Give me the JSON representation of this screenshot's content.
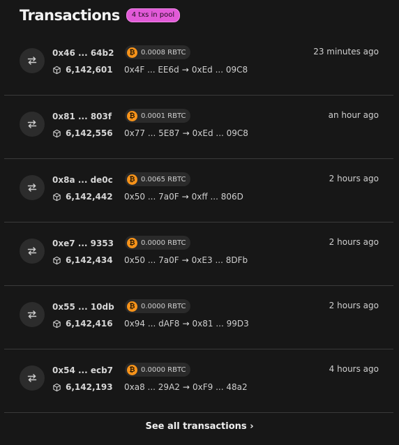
{
  "header": {
    "title": "Transactions",
    "pool_badge": "4 txs in pool"
  },
  "transactions": [
    {
      "hash": "0x46 ... 64b2",
      "block": "6,142,601",
      "amount": "0.0008 RBTC",
      "from": "0x4F ... EE6d",
      "to": "0xEd ... 09C8",
      "time": "23 minutes ago"
    },
    {
      "hash": "0x81 ... 803f",
      "block": "6,142,556",
      "amount": "0.0001 RBTC",
      "from": "0x77 ... 5E87",
      "to": "0xEd ... 09C8",
      "time": "an hour ago"
    },
    {
      "hash": "0x8a ... de0c",
      "block": "6,142,442",
      "amount": "0.0065 RBTC",
      "from": "0x50 ... 7a0F",
      "to": "0xff ... 806D",
      "time": "2 hours ago"
    },
    {
      "hash": "0xe7 ... 9353",
      "block": "6,142,434",
      "amount": "0.0000 RBTC",
      "from": "0x50 ... 7a0F",
      "to": "0xE3 ... 8DFb",
      "time": "2 hours ago"
    },
    {
      "hash": "0x55 ... 10db",
      "block": "6,142,416",
      "amount": "0.0000 RBTC",
      "from": "0x94 ... dAF8",
      "to": "0x81 ... 99D3",
      "time": "2 hours ago"
    },
    {
      "hash": "0x54 ... ecb7",
      "block": "6,142,193",
      "amount": "0.0000 RBTC",
      "from": "0xa8 ... 29A2",
      "to": "0xF9 ... 48a2",
      "time": "4 hours ago"
    }
  ],
  "icons": {
    "transfer": "arrows-swap-icon",
    "block": "cube-icon",
    "currency": "bitcoin-icon",
    "route_arrow": "arrow-right-icon",
    "chevron": "chevron-right-icon"
  },
  "symbols": {
    "route_arrow": "→",
    "bitcoin": "₿",
    "chevron": "›"
  },
  "colors": {
    "background": "#171717",
    "pool_badge": "#e25ad8",
    "bitcoin": "#f7931a"
  },
  "footer": {
    "link_label": "See all transactions"
  }
}
